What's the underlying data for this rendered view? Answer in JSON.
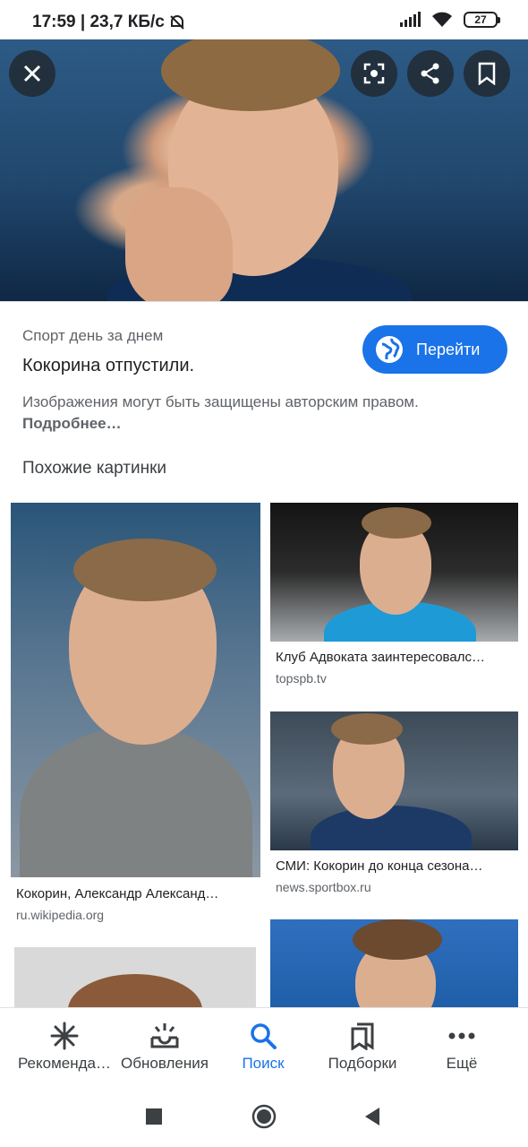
{
  "status_bar": {
    "time_and_speed": "17:59 | 23,7 КБ/с",
    "battery_level": "27",
    "icons": [
      "alarm-off-icon",
      "signal-icon",
      "wifi-icon",
      "battery-icon"
    ]
  },
  "viewer": {
    "close_icon": "close-icon",
    "lens_icon": "lens-icon",
    "share_icon": "share-icon",
    "bookmark_icon": "bookmark-icon"
  },
  "image_info": {
    "source": "Спорт день за днем",
    "title": "Кокорина отпустили.",
    "goto_label": "Перейти",
    "copyright_text": "Изображения могут быть защищены авторским правом.",
    "more_link": "Подробнее…"
  },
  "similar": {
    "heading": "Похожие картинки",
    "items": [
      {
        "caption": "Кокорин, Александр Александ…",
        "domain": "ru.wikipedia.org"
      },
      {
        "caption": "Клуб Адвоката заинтересовалс…",
        "domain": "topspb.tv"
      },
      {
        "caption": "СМИ: Кокорин до конца сезона…",
        "domain": "news.sportbox.ru"
      },
      {
        "caption": "",
        "domain": ""
      },
      {
        "caption": "",
        "domain": ""
      }
    ]
  },
  "bottom_nav": {
    "items": [
      {
        "label": "Рекоменда…",
        "icon": "asterisk-icon"
      },
      {
        "label": "Обновления",
        "icon": "updates-icon"
      },
      {
        "label": "Поиск",
        "icon": "search-icon",
        "active": true
      },
      {
        "label": "Подборки",
        "icon": "collections-icon"
      },
      {
        "label": "Ещё",
        "icon": "more-icon"
      }
    ]
  },
  "system_nav": [
    "recents-button",
    "home-button",
    "back-button"
  ],
  "colors": {
    "accent": "#1a73e8"
  }
}
